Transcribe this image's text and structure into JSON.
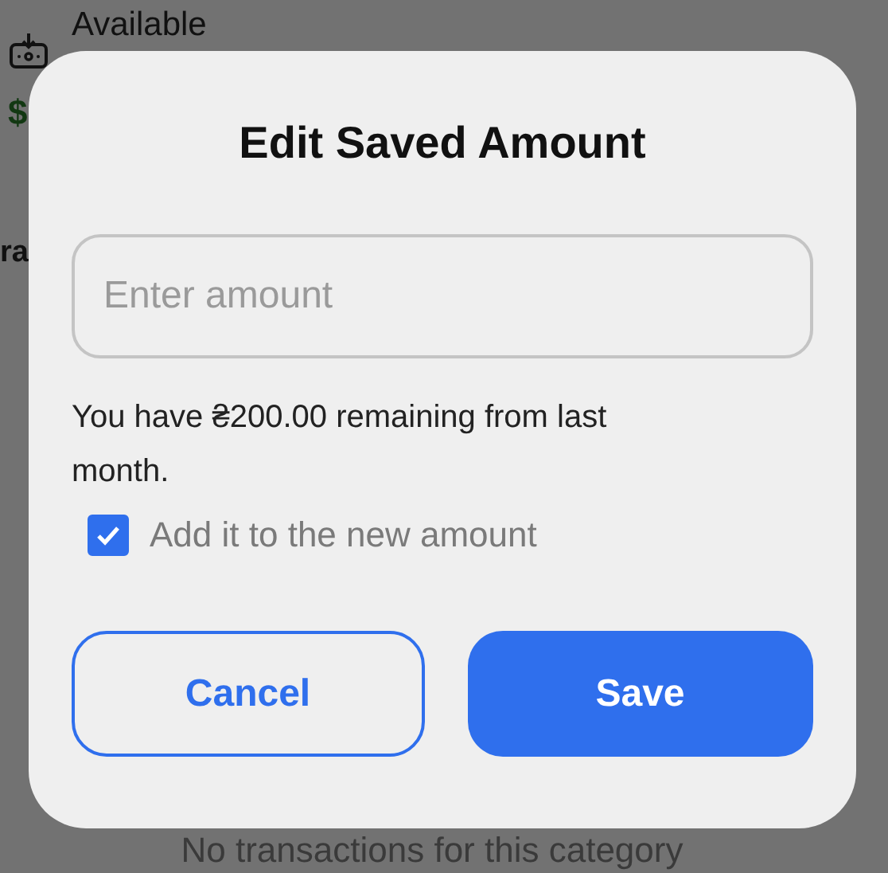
{
  "background": {
    "available_label": "Available",
    "amount_text": "$",
    "section_title": "ra",
    "empty_message": "No transactions for this category"
  },
  "dialog": {
    "title": "Edit Saved Amount",
    "amount_field": {
      "placeholder": "Enter amount"
    },
    "remaining_text": "You have ₴200.00 remaining from last month.",
    "add_to_new": {
      "label": "Add it to the new amount",
      "checked": true
    },
    "buttons": [
      {
        "label": "Cancel",
        "kind": "outline"
      },
      {
        "label": "Save",
        "kind": "filled"
      }
    ]
  }
}
